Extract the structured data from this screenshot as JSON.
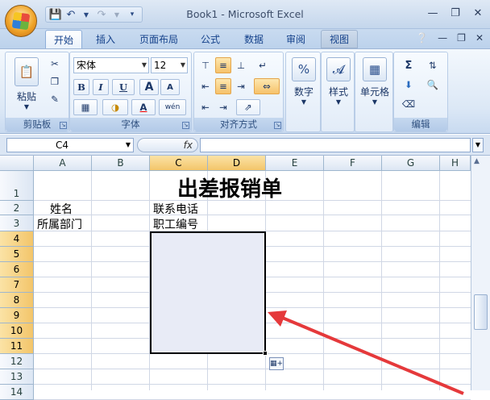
{
  "window": {
    "title": "Book1 - Microsoft Excel"
  },
  "qat": {
    "save_icon": "save-icon",
    "undo_icon": "undo-icon",
    "redo_icon": "redo-icon"
  },
  "tabs": [
    "开始",
    "插入",
    "页面布局",
    "公式",
    "数据",
    "审阅",
    "视图"
  ],
  "ribbon": {
    "clipboard": {
      "label": "剪贴板",
      "paste": "粘贴"
    },
    "font": {
      "label": "字体",
      "name": "宋体",
      "size": "12",
      "bold": "B",
      "italic": "I",
      "underline": "U",
      "grow": "A",
      "shrink": "A",
      "font_color": "A",
      "wen": "wén"
    },
    "alignment": {
      "label": "对齐方式"
    },
    "number": {
      "label": "数字",
      "percent": "%"
    },
    "styles": {
      "label": "样式"
    },
    "cells": {
      "label": "单元格"
    },
    "editing": {
      "label": "编辑",
      "sum": "Σ"
    }
  },
  "formula_bar": {
    "name_box": "C4",
    "fx": "fx",
    "content": ""
  },
  "sheet": {
    "columns": [
      "A",
      "B",
      "C",
      "D",
      "E",
      "F",
      "G",
      "H"
    ],
    "selected_columns": [
      "C",
      "D"
    ],
    "rows": [
      "1",
      "2",
      "3",
      "4",
      "5",
      "6",
      "7",
      "8",
      "9",
      "10",
      "11",
      "12",
      "13",
      "14"
    ],
    "selected_rows": [
      "4",
      "5",
      "6",
      "7",
      "8",
      "9",
      "10",
      "11"
    ],
    "cells": {
      "title": "出差报销单",
      "a2": "姓名",
      "a3": "所属部门",
      "c2": "联系电话",
      "c3": "职工编号"
    },
    "selection_range": "C4:D11"
  },
  "colors": {
    "selection_fill": "#e8ebf6",
    "header_highlight": "#f3c56a",
    "arrow": "#e5393b"
  }
}
